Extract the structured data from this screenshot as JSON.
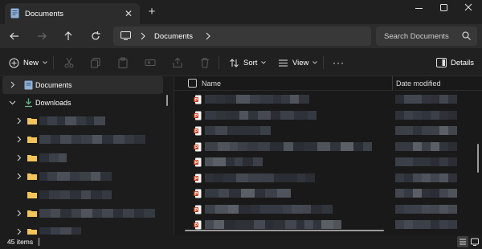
{
  "window": {
    "tab_title": "Documents",
    "tab_icon": "documents-folder-icon",
    "new_tab_icon": "plus-icon",
    "controls": [
      "minimize-icon",
      "maximize-icon",
      "close-icon"
    ]
  },
  "navigation": {
    "back_icon": "arrow-left-icon",
    "forward_icon": "arrow-right-icon",
    "up_icon": "arrow-up-icon",
    "refresh_icon": "refresh-icon",
    "breadcrumb": [
      "Documents"
    ],
    "search_placeholder": "Search Documents"
  },
  "command_bar": {
    "new_label": "New",
    "sort_label": "Sort",
    "view_label": "View",
    "more_label": "···",
    "details_label": "Details",
    "disabled_icons": [
      "cut-icon",
      "copy-icon",
      "paste-icon",
      "rename-icon",
      "share-icon",
      "delete-icon"
    ]
  },
  "nav_pane": {
    "pinned": [
      {
        "label": "Documents",
        "icon": "documents-folder-icon",
        "selected": true
      },
      {
        "label": "Downloads",
        "icon": "download-icon",
        "expanded": true
      }
    ],
    "folder_count": 8
  },
  "file_list": {
    "columns": [
      "Name",
      "Date modified"
    ],
    "file_icon": "powerpoint-file-icon",
    "rows_visible": 9
  },
  "status": {
    "item_count": "45 items"
  },
  "colors": {
    "background": "#191919",
    "panel": "#202020",
    "toolbar": "#2c2c2c",
    "accent_green": "#5fb685",
    "folder_yellow": "#f2c45a",
    "ppt_red": "#c43e1c"
  }
}
